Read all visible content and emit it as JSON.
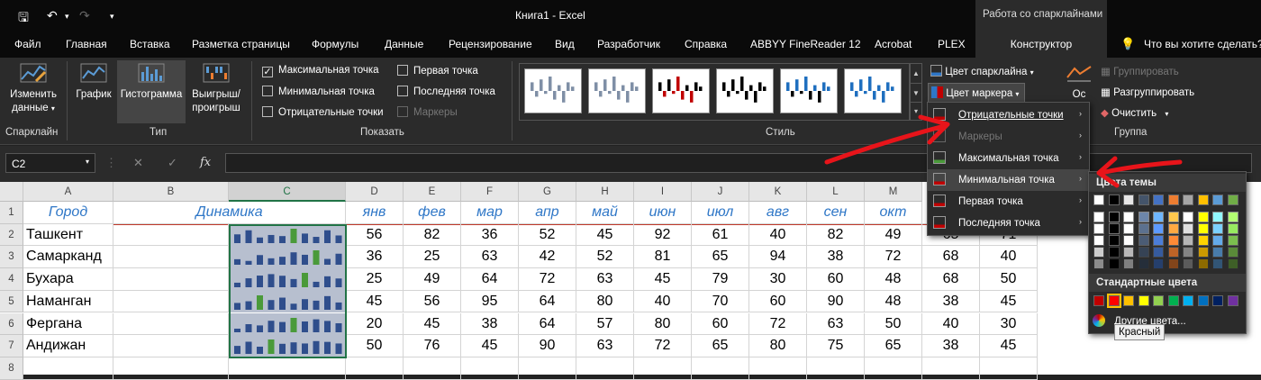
{
  "window": {
    "title": "Книга1  -  Excel",
    "context_tab_group": "Работа со спарклайнами"
  },
  "menu": {
    "tabs": [
      "Файл",
      "Главная",
      "Вставка",
      "Разметка страницы",
      "Формулы",
      "Данные",
      "Рецензирование",
      "Вид",
      "Разработчик",
      "Справка",
      "ABBYY FineReader 12",
      "Acrobat",
      "PLEX"
    ],
    "active_tab": "Конструктор",
    "tell_me": "Что вы хотите сделать?"
  },
  "ribbon": {
    "sparkline": {
      "edit_data_line1": "Изменить",
      "edit_data_line2": "данные",
      "group": "Спарклайн"
    },
    "type": {
      "line": "График",
      "column": "Гистограмма",
      "winloss_line1": "Выигрыш/",
      "winloss_line2": "проигрыш",
      "group": "Тип"
    },
    "show": {
      "high_point": "Максимальная точка",
      "high_checked": "✓",
      "low_point": "Минимальная точка",
      "negative_points": "Отрицательные точки",
      "first_point": "Первая точка",
      "last_point": "Последняя точка",
      "markers": "Маркеры",
      "group": "Показать"
    },
    "style": {
      "group": "Стиль",
      "scroll_up": "▲",
      "scroll_down": "▼",
      "scroll_more": "▾"
    },
    "colors": {
      "sparkline_color": "Цвет спарклайна",
      "marker_color": "Цвет маркера"
    },
    "axis_label": "Ос",
    "group_cmds": {
      "group": "Группировать",
      "ungroup": "Разгруппировать",
      "clear": "Очистить",
      "group_label": "Группа"
    }
  },
  "formula_bar": {
    "name_box": "C2",
    "fx": "fx",
    "cancel": "✕",
    "enter": "✓",
    "formula": ""
  },
  "columns": [
    "A",
    "B",
    "C",
    "D",
    "E",
    "F",
    "G",
    "H",
    "I",
    "J",
    "K",
    "L",
    "M"
  ],
  "selected_column": "C",
  "rows": [
    "1",
    "2",
    "3",
    "4",
    "5",
    "6",
    "7",
    "8"
  ],
  "header_row": {
    "city": "Город",
    "dynamics": "Динамика",
    "months": [
      "янв",
      "фев",
      "мар",
      "апр",
      "май",
      "июн",
      "июл",
      "авг",
      "сен",
      "окт"
    ]
  },
  "data_rows": [
    {
      "city": "Ташкент",
      "values": [
        56,
        82,
        36,
        52,
        45,
        92,
        61,
        40,
        82,
        49
      ],
      "hidden_right": [
        "65",
        "71"
      ]
    },
    {
      "city": "Самарканд",
      "values": [
        36,
        25,
        63,
        42,
        52,
        81,
        65,
        94,
        38,
        72
      ],
      "hidden_right": [
        "68",
        "40"
      ]
    },
    {
      "city": "Бухара",
      "values": [
        25,
        49,
        64,
        72,
        63,
        45,
        79,
        30,
        60,
        48
      ],
      "hidden_right": [
        "68",
        "50"
      ]
    },
    {
      "city": "Наманган",
      "values": [
        45,
        56,
        95,
        64,
        80,
        40,
        70,
        60,
        90,
        48
      ],
      "hidden_right": [
        "38",
        "45"
      ]
    },
    {
      "city": "Фергана",
      "values": [
        20,
        45,
        38,
        64,
        57,
        80,
        60,
        72,
        63,
        50
      ],
      "hidden_right": [
        "40",
        "30"
      ]
    },
    {
      "city": "Андижан",
      "values": [
        50,
        76,
        45,
        90,
        63,
        72,
        65,
        80,
        75,
        65
      ],
      "hidden_right": [
        "38",
        "45"
      ]
    }
  ],
  "marker_menu": {
    "items": [
      "Отрицательные точки",
      "Маркеры",
      "Максимальная точка",
      "Минимальная точка",
      "Первая точка",
      "Последняя точка"
    ],
    "arrow": "›"
  },
  "palette": {
    "theme_colors_title": "Цвета темы",
    "standard_colors_title": "Стандартные цвета",
    "more_colors": "Другие цвета...",
    "tooltip": "Красный",
    "theme_top": [
      "#ffffff",
      "#000000",
      "#e7e6e6",
      "#44546a",
      "#4472c4",
      "#ed7d31",
      "#a5a5a5",
      "#ffc000",
      "#5b9bd5",
      "#70ad47"
    ],
    "standard": [
      "#c00000",
      "#ff0000",
      "#ffc000",
      "#ffff00",
      "#92d050",
      "#00b050",
      "#00b0f0",
      "#0070c0",
      "#002060",
      "#7030a0"
    ]
  },
  "colors": {
    "accent_green": "#217346",
    "header_blue": "#2f77c7",
    "spark_bar": "#2f4e8c",
    "spark_max": "#4a9a3a",
    "annotation_red": "#e8141a"
  }
}
